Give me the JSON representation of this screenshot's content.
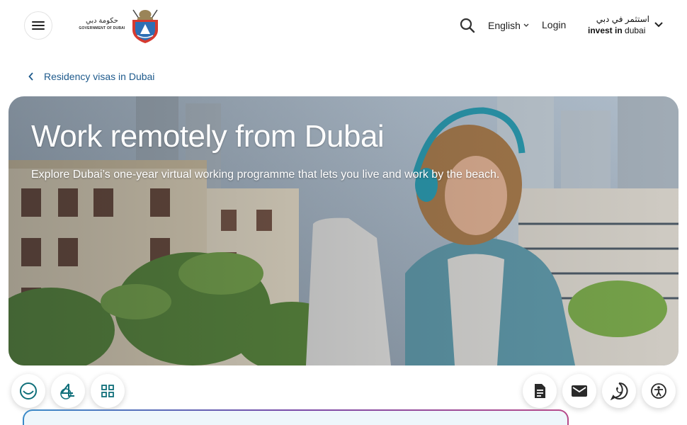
{
  "header": {
    "menu_icon": "hamburger-menu-icon",
    "gov_logo": {
      "arabic": "حكومة دبي",
      "english": "GOVERNMENT OF DUBAI"
    },
    "search_icon": "search-icon",
    "language": "English",
    "login": "Login",
    "invest_logo": {
      "arabic": "استثمر في دبي",
      "english_bold": "invest in",
      "english": "dubai"
    }
  },
  "breadcrumb": {
    "label": "Residency visas in Dubai"
  },
  "hero": {
    "title": "Work remotely from Dubai",
    "subtitle": "Explore Dubai’s one-year virtual working programme that lets you live and work by the beach."
  },
  "floating_left": [
    "happiness-meter-icon",
    "dubai-app-icon",
    "apps-grid-icon"
  ],
  "floating_right": [
    "document-icon",
    "mail-icon",
    "whatsapp-icon",
    "accessibility-icon"
  ],
  "colors": {
    "link": "#1e5a8c",
    "fab_icon": "#2a2a2a",
    "accent_teal": "#0f6f7a"
  }
}
